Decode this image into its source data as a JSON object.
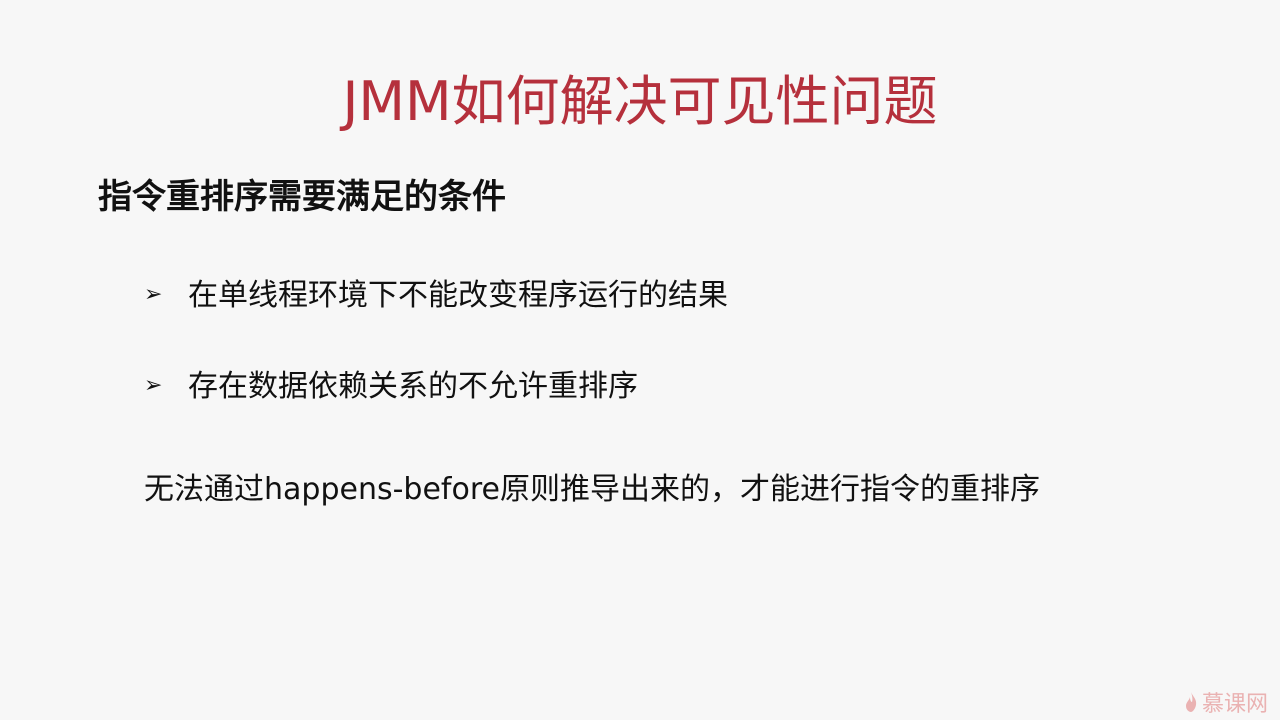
{
  "slide": {
    "title": "JMM如何解决可见性问题",
    "heading": "指令重排序需要满足的条件",
    "bullets": [
      {
        "marker": "➢",
        "text": "在单线程环境下不能改变程序运行的结果"
      },
      {
        "marker": "➢",
        "text": "存在数据依赖关系的不允许重排序"
      }
    ],
    "note": "无法通过happens-before原则推导出来的，才能进行指令的重排序"
  },
  "watermark": {
    "text": "慕课网",
    "icon": "flame-icon"
  }
}
